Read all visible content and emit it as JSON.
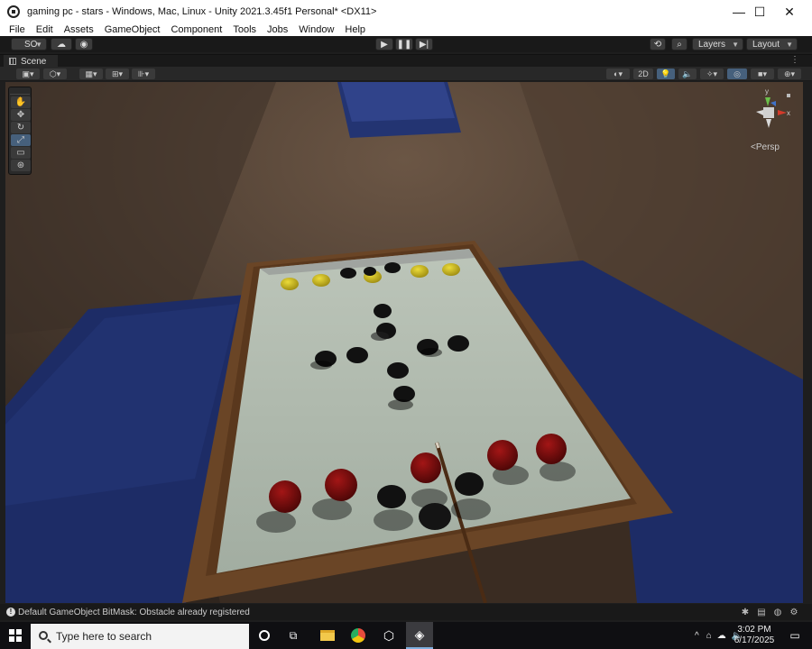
{
  "window": {
    "title": "gaming pc - stars - Windows, Mac, Linux - Unity 2021.3.45f1 Personal* <DX11>",
    "minimize": "—",
    "maximize": "☐",
    "close": "✕"
  },
  "menu": [
    "File",
    "Edit",
    "Assets",
    "GameObject",
    "Component",
    "Tools",
    "Jobs",
    "Window",
    "Help"
  ],
  "toolbar": {
    "account": "SO",
    "layers": "Layers",
    "layout": "Layout"
  },
  "scene_tab": {
    "label": "Scene"
  },
  "scene_toolbar": {
    "mode_2d": "2D"
  },
  "gizmo": {
    "projection": "Persp",
    "y_label": "y",
    "x_label": "x"
  },
  "status": {
    "message": "Default GameObject BitMask: Obstacle already registered"
  },
  "taskbar": {
    "search_placeholder": "Type here to search",
    "time": "3:02 PM",
    "date": "6/17/2025"
  },
  "colors": {
    "felt": "#a9b4a8",
    "rail": "#6a4526",
    "room_wall": "#4a3a2e",
    "blue_floor": "#1f2f66",
    "yellow_piece": "#d6c21a",
    "red_piece": "#7a0c0c",
    "black_piece": "#111111"
  }
}
